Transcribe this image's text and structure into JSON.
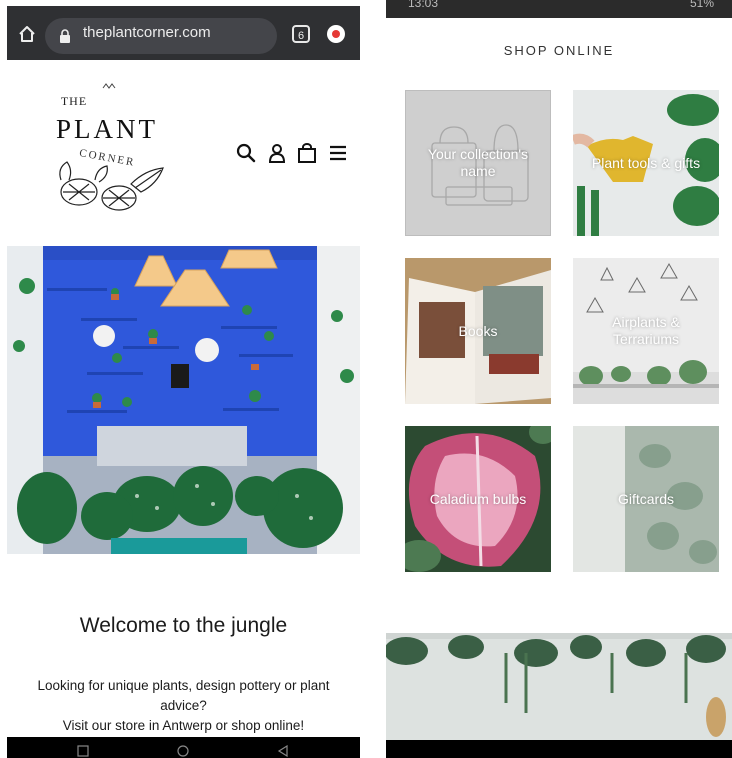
{
  "browser": {
    "url": "theplantcorner.com",
    "tab_count": "6"
  },
  "site": {
    "logo": {
      "the": "THE",
      "plant": "PLANT",
      "corner": "CORNER"
    },
    "welcome_heading": "Welcome to the jungle",
    "intro_line1": "Looking for unique plants, design pottery or plant advice?",
    "intro_line2": "Visit our store in Antwerp or shop online!"
  },
  "status": {
    "time": "13:03",
    "battery": "51%"
  },
  "shop": {
    "title": "SHOP ONLINE",
    "collections": [
      {
        "label": "Your collection's name"
      },
      {
        "label": "Plant tools & gifts"
      },
      {
        "label": "Books"
      },
      {
        "label": "Airplants & Terrariums"
      },
      {
        "label": "Caladium bulbs"
      },
      {
        "label": "Giftcards"
      }
    ]
  },
  "icons": [
    "home-icon",
    "lock-icon",
    "tabs-icon",
    "update-icon",
    "search-icon",
    "account-icon",
    "cart-icon",
    "menu-icon",
    "back-icon",
    "home-nav-icon",
    "recents-icon"
  ],
  "colors": {
    "browser_bar": "#2f3033",
    "hero_wall": "#3057d6",
    "placeholder_tile": "#cfcfcf"
  }
}
